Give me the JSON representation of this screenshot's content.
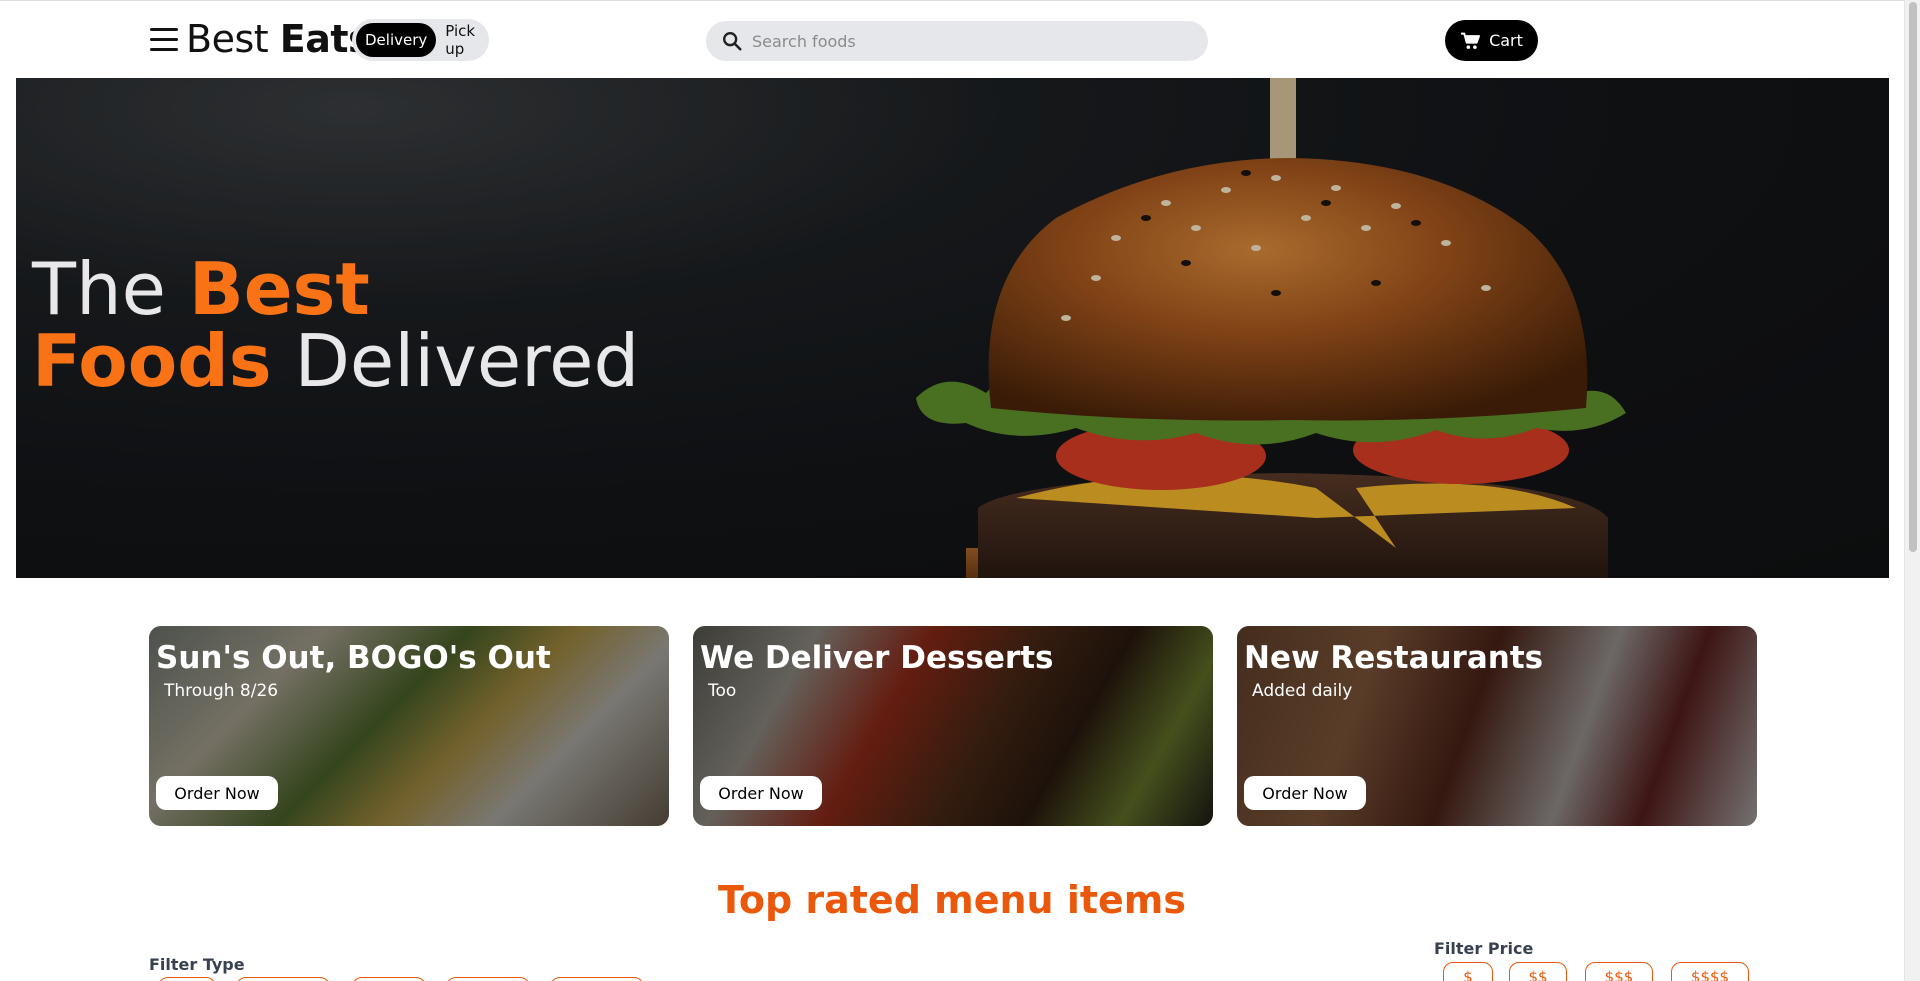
{
  "header": {
    "logo_regular": "Best",
    "logo_bold": "Eats",
    "modes": [
      "Delivery",
      "Pick up"
    ],
    "active_mode": "Delivery",
    "search_placeholder": "Search foods",
    "cart_label": "Cart"
  },
  "hero": {
    "line1_plain": "The",
    "line1_accent": "Best",
    "line2_accent": "Foods",
    "line2_plain": "Delivered"
  },
  "promos": [
    {
      "title": "Sun's Out, BOGO's Out",
      "subtitle": "Through 8/26",
      "button": "Order Now"
    },
    {
      "title": "We Deliver Desserts",
      "subtitle": "Too",
      "button": "Order Now"
    },
    {
      "title": "New Restaurants",
      "subtitle": "Added daily",
      "button": "Order Now"
    }
  ],
  "section": {
    "title": "Top rated menu items",
    "filter_type_label": "Filter Type",
    "filter_price_label": "Filter Price",
    "price_options": [
      "$",
      "$$",
      "$$$",
      "$$$$"
    ]
  },
  "colors": {
    "accent": "#f97316",
    "section_title": "#ea580c",
    "chip_border": "#ea580c",
    "pill_bg": "#e5e7eb",
    "dark": "#000000"
  },
  "icons": [
    "hamburger-menu-icon",
    "search-icon",
    "cart-icon"
  ]
}
